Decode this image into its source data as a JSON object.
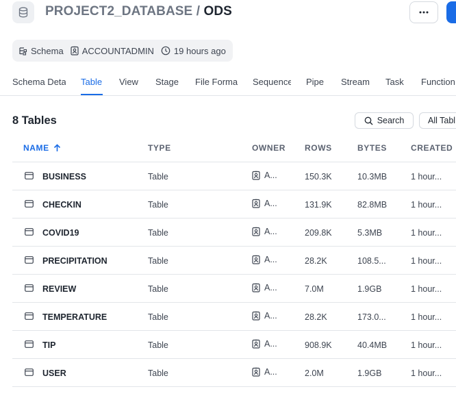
{
  "header": {
    "database": "PROJECT2_DATABASE",
    "separator": "/",
    "schema": "ODS",
    "more_label": "⋯"
  },
  "meta": {
    "kind": "Schema",
    "owner": "ACCOUNTADMIN",
    "time": "19 hours ago"
  },
  "tabs": [
    {
      "label": "Schema Deta",
      "active": false
    },
    {
      "label": "Table",
      "active": true
    },
    {
      "label": "View",
      "active": false
    },
    {
      "label": "Stage",
      "active": false
    },
    {
      "label": "File Forma",
      "active": false
    },
    {
      "label": "Sequence",
      "active": false
    },
    {
      "label": "Pipe",
      "active": false
    },
    {
      "label": "Stream",
      "active": false
    },
    {
      "label": "Task",
      "active": false
    },
    {
      "label": "Function",
      "active": false
    }
  ],
  "list": {
    "count_label": "8 Tables",
    "search_label": "Search",
    "filter_label": "All Tabl"
  },
  "columns": {
    "name": "NAME",
    "type": "TYPE",
    "owner": "OWNER",
    "rows": "ROWS",
    "bytes": "BYTES",
    "created": "CREATED"
  },
  "rows": [
    {
      "name": "BUSINESS",
      "type": "Table",
      "owner": "A...",
      "rows": "150.3K",
      "bytes": "10.3MB",
      "created": "1 hour..."
    },
    {
      "name": "CHECKIN",
      "type": "Table",
      "owner": "A...",
      "rows": "131.9K",
      "bytes": "82.8MB",
      "created": "1 hour..."
    },
    {
      "name": "COVID19",
      "type": "Table",
      "owner": "A...",
      "rows": "209.8K",
      "bytes": "5.3MB",
      "created": "1 hour..."
    },
    {
      "name": "PRECIPITATION",
      "type": "Table",
      "owner": "A...",
      "rows": "28.2K",
      "bytes": "108.5...",
      "created": "1 hour..."
    },
    {
      "name": "REVIEW",
      "type": "Table",
      "owner": "A...",
      "rows": "7.0M",
      "bytes": "1.9GB",
      "created": "1 hour..."
    },
    {
      "name": "TEMPERATURE",
      "type": "Table",
      "owner": "A...",
      "rows": "28.2K",
      "bytes": "173.0...",
      "created": "1 hour..."
    },
    {
      "name": "TIP",
      "type": "Table",
      "owner": "A...",
      "rows": "908.9K",
      "bytes": "40.4MB",
      "created": "1 hour..."
    },
    {
      "name": "USER",
      "type": "Table",
      "owner": "A...",
      "rows": "2.0M",
      "bytes": "1.9GB",
      "created": "1 hour..."
    }
  ],
  "colors": {
    "accent": "#1a6ce6",
    "text": "#1e252f",
    "muted": "#6d7582",
    "border": "#e2e5e9"
  },
  "icons": {
    "database": "database-icon",
    "more": "more-horizontal-icon",
    "schema": "schema-icon",
    "owner": "user-badge-icon",
    "time": "clock-icon",
    "search": "search-icon",
    "sort": "arrow-up-icon",
    "table": "table-icon"
  }
}
